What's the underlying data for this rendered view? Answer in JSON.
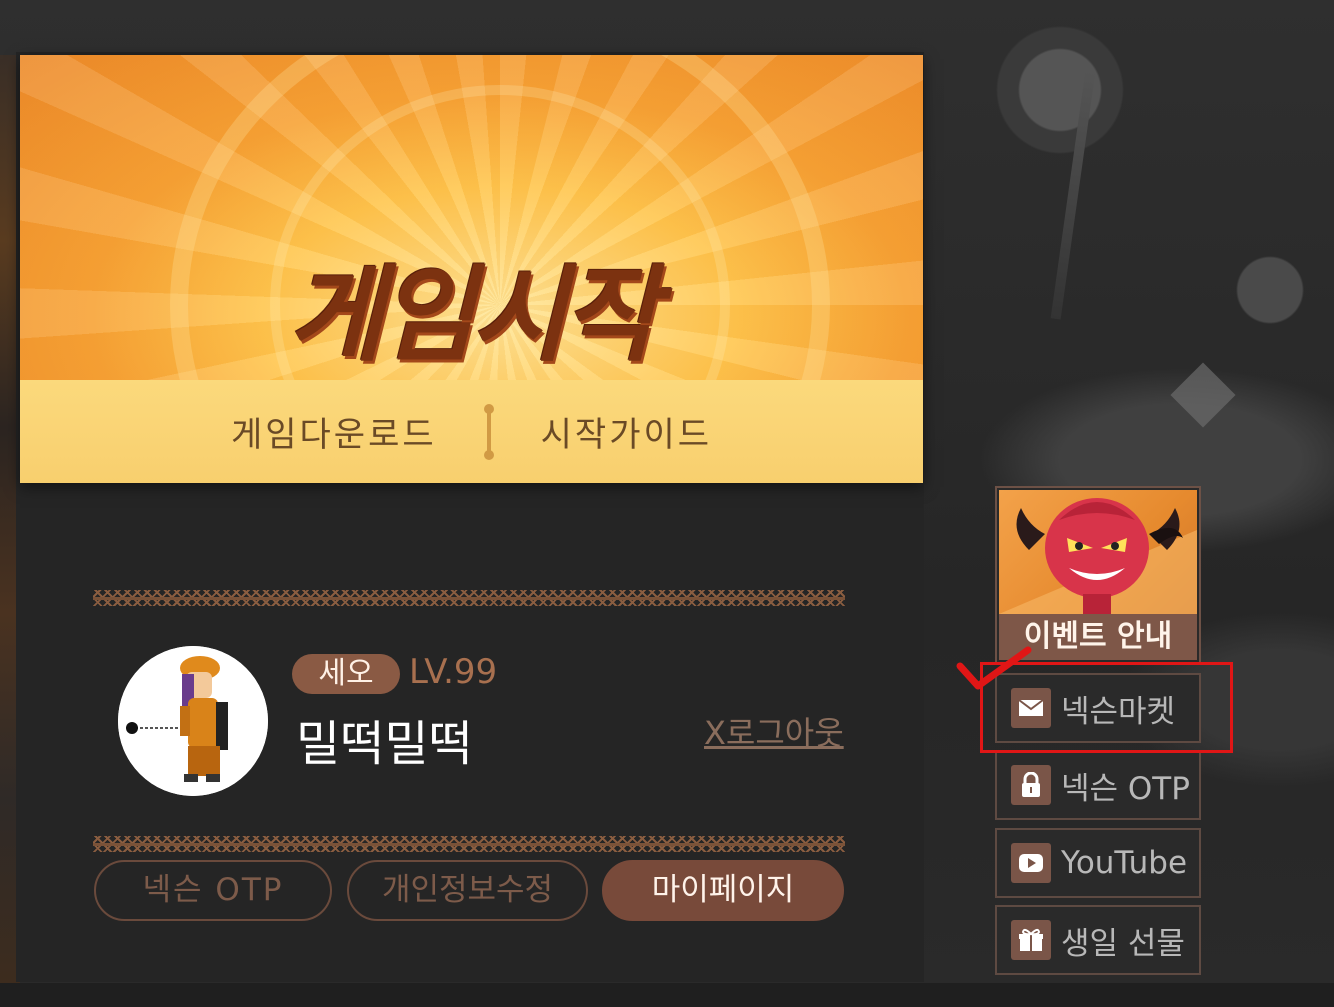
{
  "banner": {
    "title": "게임시작",
    "download_label": "게임다운로드",
    "guide_label": "시작가이드"
  },
  "profile": {
    "server": "세오",
    "level": "LV.99",
    "name": "밀떡밀떡",
    "logout_label": "X로그아웃"
  },
  "buttons": {
    "otp": "넥슨 OTP",
    "edit_info": "개인정보수정",
    "mypage": "마이페이지"
  },
  "side_menu": {
    "event": "이벤트 안내",
    "items": [
      {
        "label": "넥슨마켓",
        "icon": "envelope-icon"
      },
      {
        "label": "넥슨 OTP",
        "icon": "lock-icon"
      },
      {
        "label": "YouTube",
        "icon": "play-icon"
      },
      {
        "label": "생일 선물",
        "icon": "gift-icon"
      }
    ]
  },
  "annotation": {
    "highlight_color": "#e01616",
    "highlighted_item": "넥슨마켓"
  },
  "colors": {
    "accent_brown": "#784a3a",
    "banner_orange": "#f7a336",
    "panel_bg": "#252525"
  }
}
